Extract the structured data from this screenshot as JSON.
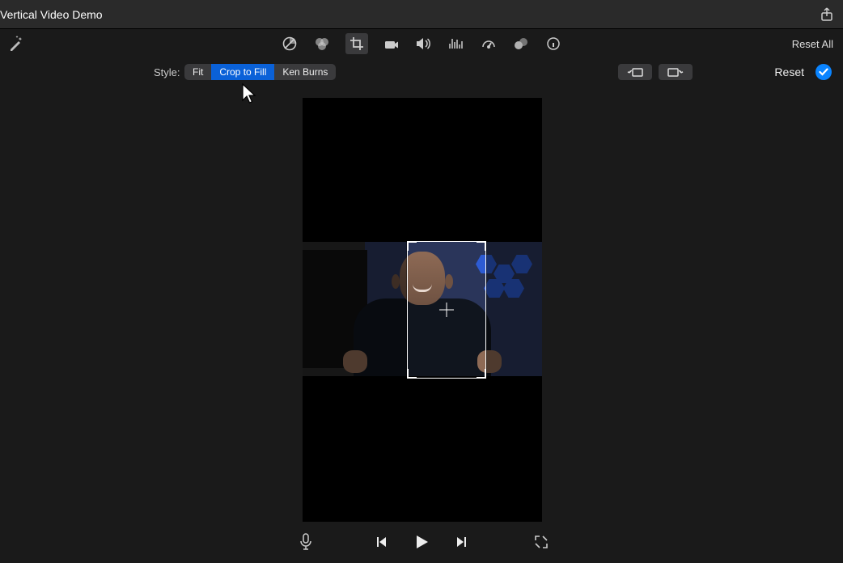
{
  "header": {
    "title": "Vertical Video Demo"
  },
  "toolbar": {
    "reset_all": "Reset All"
  },
  "stylebar": {
    "label": "Style:",
    "fit": "Fit",
    "crop_to_fill": "Crop to Fill",
    "ken_burns": "Ken Burns",
    "selected": "Crop to Fill",
    "reset": "Reset"
  }
}
